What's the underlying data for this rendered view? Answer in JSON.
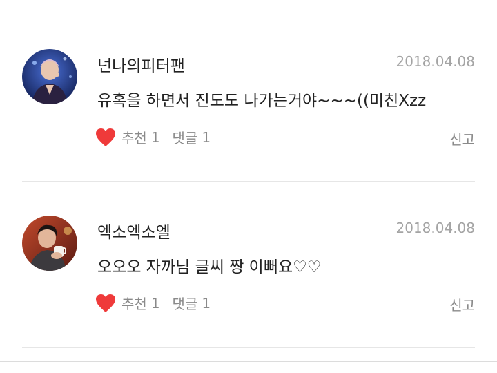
{
  "comments": [
    {
      "author": "넌나의피터팬",
      "date": "2018.04.08",
      "text": "유혹을 하면서 진도도 나가는거야~~~((미친Xzz",
      "like_label": "추천",
      "like_count": "1",
      "reply_label": "댓글",
      "reply_count": "1",
      "report_label": "신고",
      "avatar_icon": "user-avatar-photo"
    },
    {
      "author": "엑소엑소엘",
      "date": "2018.04.08",
      "text": "오오오 자까님 글씨 짱 이뻐요♡♡",
      "like_label": "추천",
      "like_count": "1",
      "reply_label": "댓글",
      "reply_count": "1",
      "report_label": "신고",
      "avatar_icon": "user-avatar-photo"
    }
  ],
  "colors": {
    "heart": "#ef3a3a",
    "text": "#222222",
    "meta": "#8a8a8a",
    "date": "#a4a4a4",
    "divider": "#e6e6e6"
  }
}
